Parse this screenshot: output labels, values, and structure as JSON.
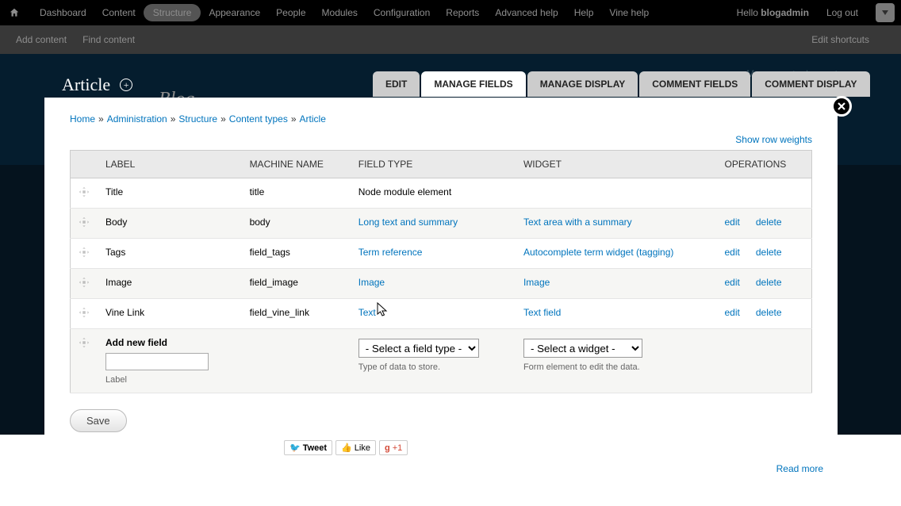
{
  "admin": {
    "menu": [
      "Dashboard",
      "Content",
      "Structure",
      "Appearance",
      "People",
      "Modules",
      "Configuration",
      "Reports",
      "Advanced help",
      "Help",
      "Vine help"
    ],
    "active_index": 2,
    "hello_prefix": "Hello ",
    "hello_user": "blogadmin",
    "logout": "Log out"
  },
  "shortcuts": {
    "items": [
      "Add content",
      "Find content"
    ],
    "edit": "Edit shortcuts"
  },
  "site": {
    "title": "Blog",
    "account": "My account",
    "logout": "Log out"
  },
  "overlay": {
    "title": "Article",
    "tabs": [
      "EDIT",
      "MANAGE FIELDS",
      "MANAGE DISPLAY",
      "COMMENT FIELDS",
      "COMMENT DISPLAY"
    ],
    "active_tab": 1,
    "breadcrumb": [
      "Home",
      "Administration",
      "Structure",
      "Content types",
      "Article"
    ],
    "show_weights": "Show row weights",
    "headers": {
      "label": "LABEL",
      "machine": "MACHINE NAME",
      "field": "FIELD TYPE",
      "widget": "WIDGET",
      "ops": "OPERATIONS"
    },
    "rows": [
      {
        "label": "Title",
        "machine": "title",
        "field": "Node module element",
        "field_link": false
      },
      {
        "label": "Body",
        "machine": "body",
        "field": "Long text and summary",
        "widget": "Text area with a summary",
        "edit": "edit",
        "delete": "delete",
        "field_link": true
      },
      {
        "label": "Tags",
        "machine": "field_tags",
        "field": "Term reference",
        "widget": "Autocomplete term widget (tagging)",
        "edit": "edit",
        "delete": "delete",
        "field_link": true
      },
      {
        "label": "Image",
        "machine": "field_image",
        "field": "Image",
        "widget": "Image",
        "edit": "edit",
        "delete": "delete",
        "field_link": true
      },
      {
        "label": "Vine Link",
        "machine": "field_vine_link",
        "field": "Text",
        "widget": "Text field",
        "edit": "edit",
        "delete": "delete",
        "field_link": true
      }
    ],
    "addnew": {
      "title": "Add new field",
      "label_help": "Label",
      "type_placeholder": "- Select a field type -",
      "type_help": "Type of data to store.",
      "widget_placeholder": "- Select a widget -",
      "widget_help": "Form element to edit the data."
    },
    "save": "Save"
  },
  "social": {
    "tweet": "Tweet",
    "like": "Like",
    "gplus": "+1"
  },
  "readmore": "Read more"
}
